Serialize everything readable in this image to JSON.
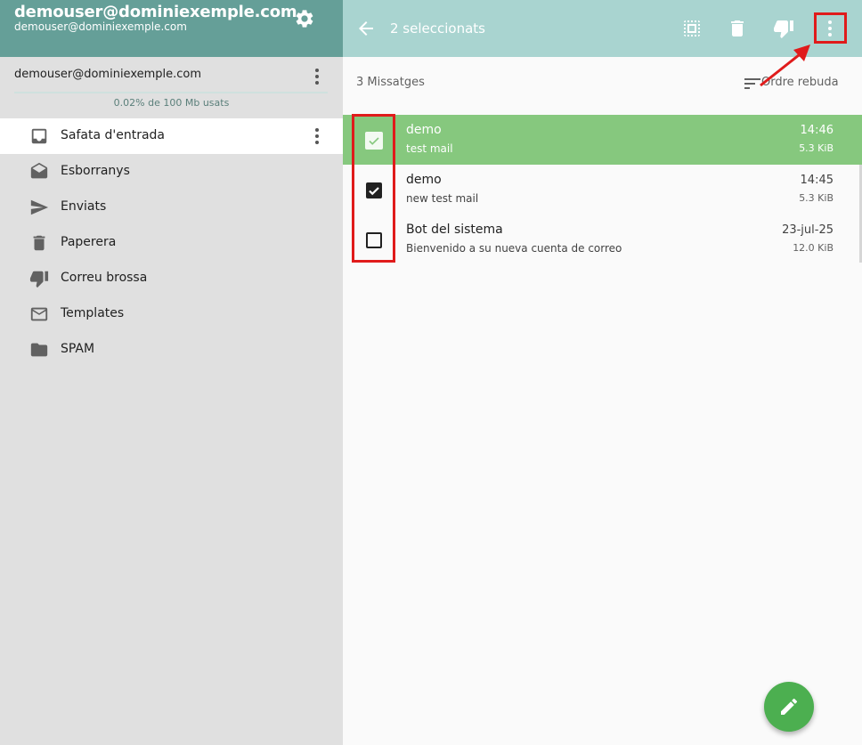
{
  "sidebar": {
    "header_title": "demouser@dominiexemple.com",
    "header_subtitle": "demouser@dominiexemple.com",
    "account": "demouser@dominiexemple.com",
    "quota": "0.02% de 100 Mb usats",
    "quota_percent": 0.02,
    "folders": [
      {
        "label": "Safata d'entrada",
        "icon": "inbox-icon"
      },
      {
        "label": "Esborranys",
        "icon": "drafts-icon"
      },
      {
        "label": "Enviats",
        "icon": "send-icon"
      },
      {
        "label": "Paperera",
        "icon": "trash-icon"
      },
      {
        "label": "Correu brossa",
        "icon": "thumbs-down-icon"
      },
      {
        "label": "Templates",
        "icon": "mail-icon"
      },
      {
        "label": "SPAM",
        "icon": "folder-icon"
      }
    ]
  },
  "toolbar": {
    "selected_label": "2 seleccionats",
    "icons": [
      "back-arrow-icon",
      "select-all-icon",
      "delete-icon",
      "junk-icon",
      "more-vert-icon"
    ]
  },
  "list": {
    "count": "3 Missatges",
    "sort_label": "Ordre rebuda",
    "messages": [
      {
        "from": "demo",
        "subject": "test mail",
        "time": "14:46",
        "size": "5.3 KiB",
        "checked": true,
        "highlighted": true
      },
      {
        "from": "demo",
        "subject": "new test mail",
        "time": "14:45",
        "size": "5.3 KiB",
        "checked": true,
        "highlighted": false
      },
      {
        "from": "Bot del sistema",
        "subject": "Bienvenido a su nueva cuenta de correo",
        "time": "23-jul-25",
        "size": "12.0 KiB",
        "checked": false,
        "highlighted": false
      }
    ]
  },
  "colors": {
    "sidebar_header": "#659f98",
    "toolbar": "#a9d4d0",
    "selected_row": "#86c87e",
    "fab": "#4caf50",
    "annotation": "#e01b1b"
  }
}
